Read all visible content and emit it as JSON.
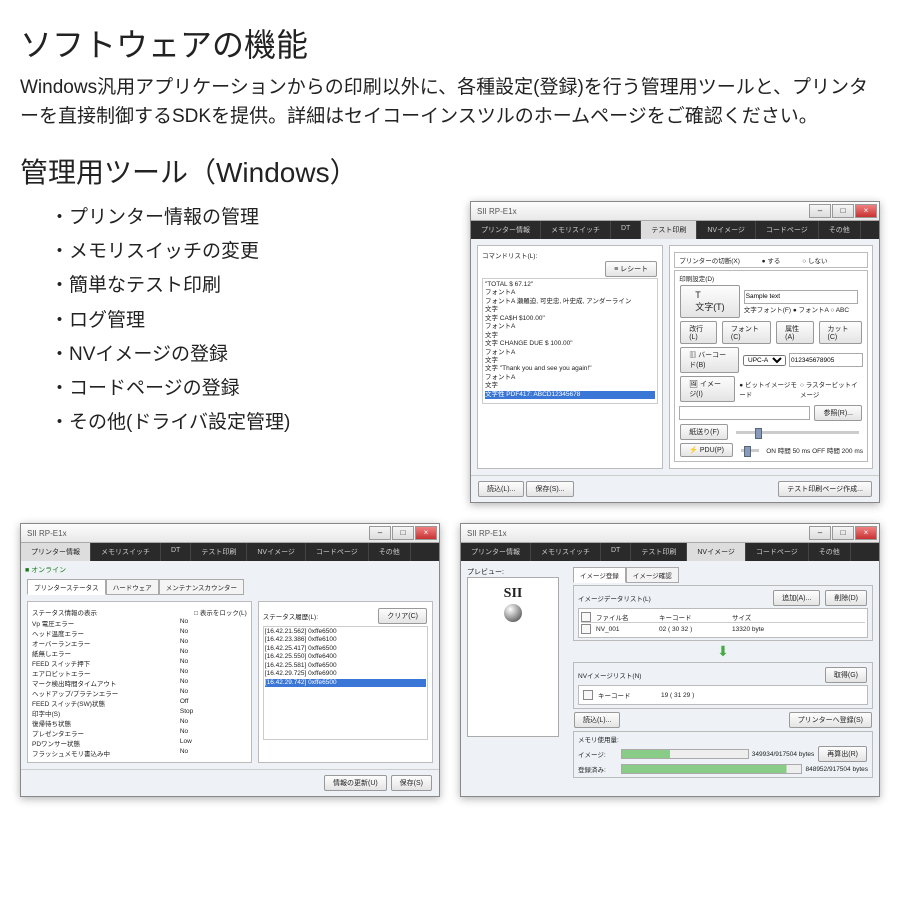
{
  "h1": "ソフトウェアの機能",
  "desc": "Windows汎用アプリケーションからの印刷以外に、各種設定(登録)を行う管理用ツールと、プリンターを直接制御するSDKを提供。詳細はセイコーインスツルのホームページをご確認ください。",
  "h2": "管理用ツール（Windows）",
  "bullets": [
    "・プリンター情報の管理",
    "・メモリスイッチの変更",
    "・簡単なテスト印刷",
    "・ログ管理",
    "・NVイメージの登録",
    "・コードページの登録",
    "・その他(ドライバ設定管理)"
  ],
  "winTitle": "SII RP-E1x",
  "tabs": [
    "プリンター情報",
    "メモリスイッチ",
    "DT",
    "テスト印刷",
    "NVイメージ",
    "コードページ",
    "その他"
  ],
  "win1": {
    "activeTab": "テスト印刷",
    "left": {
      "label": "コマンドリスト(L):",
      "clear": "≡ レシート",
      "lines": [
        "\"TOTAL          $ 67.12\"",
        "フォントA",
        "フォントA  瀬羅迫, 可史忠, 叶史成, アンダーライン",
        "文字",
        "文字   CA$H     $100.00\"",
        "フォントA",
        "文字",
        "文字   CHANGE DUE    $ 100.00\"",
        "フォントA",
        "文字",
        "文字  \"Thank you and see you again!\"",
        "フォントA",
        "文字",
        "文字性   PDF417: ABCD12345678"
      ]
    },
    "right": {
      "cutTitle": "プリンターの切断(X)",
      "cutYes": "● する",
      "cutNo": "○ しない",
      "opTitle": "印刷設定(D)",
      "btns": [
        "文字(T)",
        "改行(L)",
        "紙送り(F)",
        "フォント(C)",
        "属性(A)",
        "カット(C)",
        "バーコード(B)",
        "イメージ(I)",
        "PDU(P)"
      ],
      "sample": "Sample text",
      "fontLbl": "文字フォント(F)",
      "fontA": "● フォントA",
      "fontB": "○ ABC",
      "barcodeType": "UPC-A",
      "barcodeVal": "012345678905",
      "bitLbl": "● ビットイメージモード",
      "rasLbl": "○ ラスタービットイメージ",
      "refBtn": "参照(R)...",
      "onLbl": "ON 時間 50 ms  OFF 時間 200 ms"
    },
    "footer": {
      "load": "読込(L)...",
      "save": "保存(S)...",
      "test": "テスト印刷ページ作成..."
    }
  },
  "win2": {
    "activeTab": "プリンター情報",
    "status": "■ オンライン",
    "subtabs": [
      "プリンターステータス",
      "ハードウェア",
      "メンテナンスカウンター"
    ],
    "leftTitle": "ステータス情報の表示",
    "chk": "□ 表示をロック(L)",
    "rows": [
      [
        "Vp 電圧エラー",
        "No"
      ],
      [
        "ヘッド温度エラー",
        "No"
      ],
      [
        "オーバーランエラー",
        "No"
      ],
      [
        "紙無しエラー",
        "No"
      ],
      [
        "FEED スイッチ押下",
        "No"
      ],
      [
        "エアロビットエラー",
        "No"
      ],
      [
        "マーク検出時間タイムアウト",
        "No"
      ],
      [
        "ヘッドアップ/プラテンエラー",
        "No"
      ],
      [
        "FEED スイッチ(SW)状態",
        "Off"
      ],
      [
        "印字中(S)",
        "Stop"
      ],
      [
        "復帰待ち状態",
        "No"
      ],
      [
        "プレゼンタエラー",
        "No"
      ],
      [
        "PDワンサー状態",
        "Low"
      ],
      [
        "フラッシュメモリ書込み中",
        "No"
      ]
    ],
    "rightTitle": "ステータス履歴(L):",
    "clear": "クリア(C)",
    "hist": [
      "[16.42.21.562] 0xffe6500",
      "[16.42.23.386] 0xffe6100",
      "[16.42.25.417] 0xffe6500",
      "[16.42.25.550] 0xffe6400",
      "[16.42.25.581] 0xffe6500",
      "[16.42.29.725] 0xffe6900",
      "[16.42.29.742] 0xffe6500"
    ],
    "footer": {
      "upd": "情報の更新(U)",
      "save": "保存(S)"
    }
  },
  "win3": {
    "activeTab": "NVイメージ",
    "preview": "プレビュー:",
    "logo": "SII",
    "rtabs": [
      "イメージ登録",
      "イメージ確認"
    ],
    "listTitle": "イメージデータリスト(L)",
    "add": "追加(A)...",
    "del": "削除(D)",
    "cols": [
      "ファイル名",
      "キーコード",
      "サイズ"
    ],
    "row": [
      "NV_001",
      "02 ( 30 32 )",
      "13320 byte"
    ],
    "nvTitle": "NVイメージリスト(N)",
    "acq": "取得(G)",
    "nvKey": "キーコード",
    "nvVal": "19 ( 31 29 )",
    "loadBtn": "読込(L)...",
    "sendBtn": "プリンターへ登録(S)",
    "memTitle": "メモリ使用量:",
    "imgMem": "イメージ:",
    "regMem": "登録済み:",
    "imgVal": "349934/917504 bytes",
    "regVal": "848952/917504 bytes",
    "recalc": "再算出(R)"
  }
}
